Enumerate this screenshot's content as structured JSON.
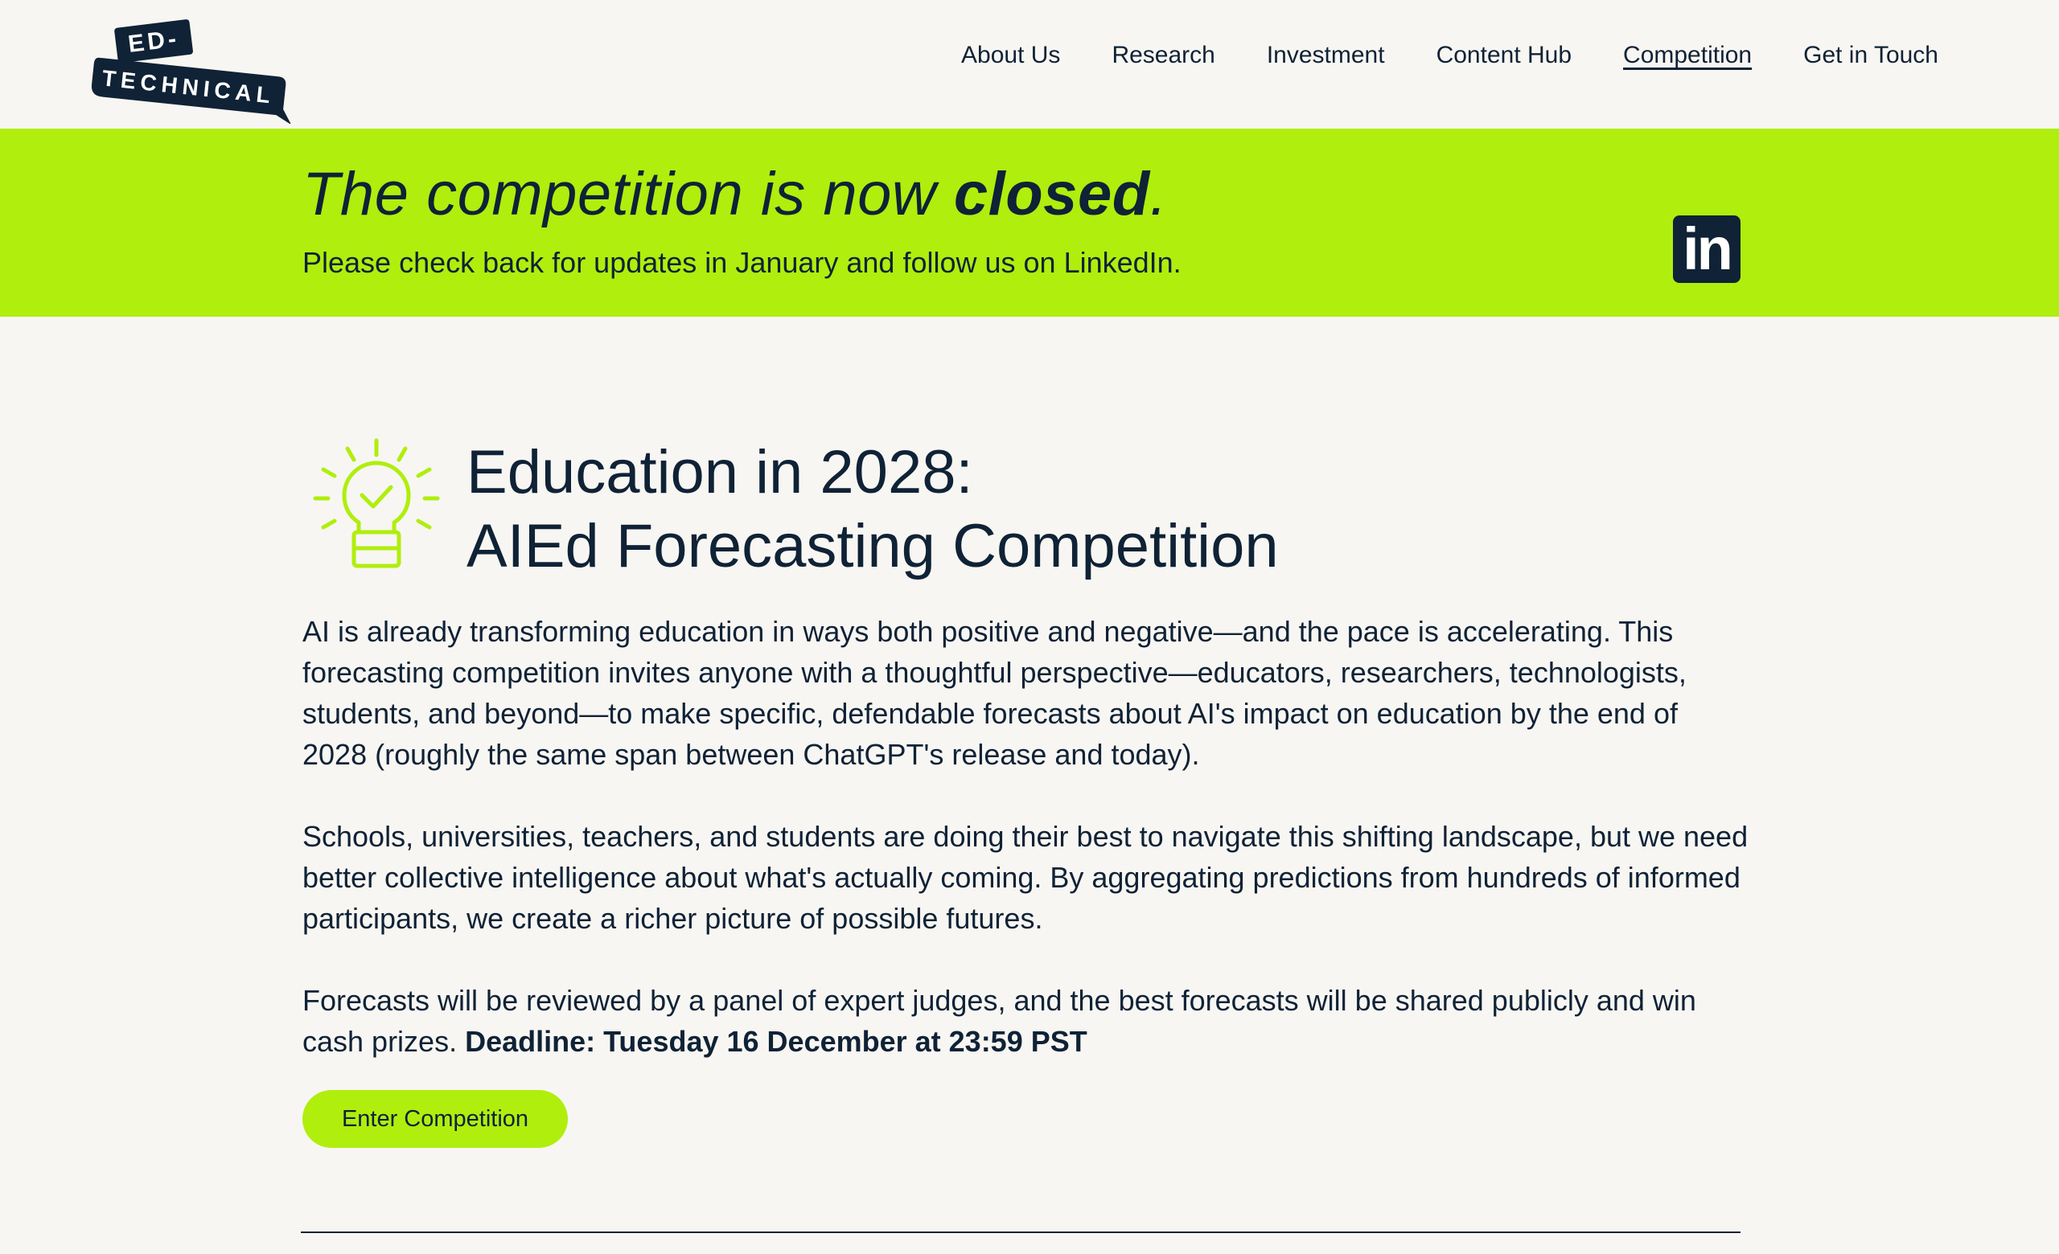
{
  "logo": {
    "line1": "ED-",
    "line2": "TECHNICAL"
  },
  "nav": {
    "items": [
      {
        "label": "About Us"
      },
      {
        "label": "Research"
      },
      {
        "label": "Investment"
      },
      {
        "label": "Content Hub"
      },
      {
        "label": "Competition",
        "active": true
      },
      {
        "label": "Get in Touch"
      }
    ]
  },
  "banner": {
    "title_prefix": "The competition is now ",
    "title_emphasis": "closed",
    "title_suffix": ".",
    "subtitle": "Please check back for updates in January and follow us on LinkedIn.",
    "linkedin_glyph": "in"
  },
  "main": {
    "icon": "lightbulb-check-icon",
    "title_line1": "Education in 2028:",
    "title_line2": "AIEd Forecasting Competition",
    "paragraph1": "AI is already transforming education in ways both positive and negative—and the pace is accelerating. This forecasting competition invites anyone with a thoughtful perspective—educators, researchers, technologists, students, and beyond—to make specific, defendable forecasts about AI's impact on education by the end of 2028 (roughly the same span between ChatGPT's release and today).",
    "paragraph2": "Schools, universities, teachers, and students are doing their best to navigate this shifting landscape, but we need better collective intelligence about what's actually coming. By aggregating predictions from hundreds of informed participants, we create a richer picture of possible futures.",
    "paragraph3_text": "Forecasts will be reviewed by a panel of expert judges, and the best forecasts will be shared publicly and win cash prizes. ",
    "paragraph3_bold": "Deadline: Tuesday 16 December at 23:59 PST",
    "button_label": "Enter Competition"
  },
  "colors": {
    "accent": "#b0ee0e",
    "ink": "#0f2236",
    "background": "#f8f6f2"
  }
}
